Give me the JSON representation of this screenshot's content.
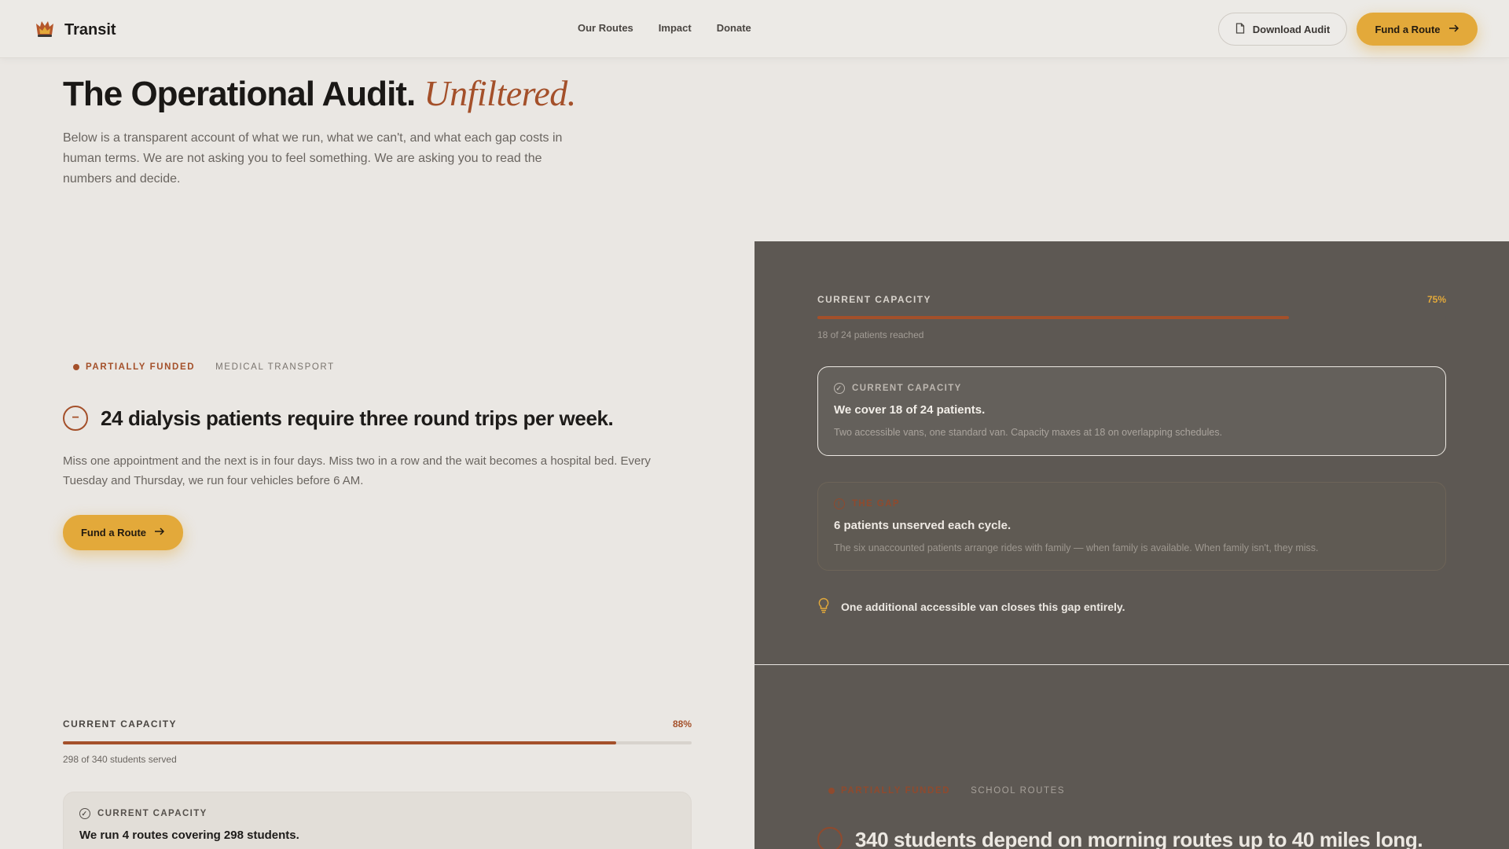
{
  "header": {
    "logo_text": "Transit",
    "logo_icon": "flame-emblem-icon",
    "nav": [
      "Our Routes",
      "Impact",
      "Donate"
    ],
    "download_label": "Download Audit",
    "fund_label": "Fund a Route"
  },
  "hero": {
    "title": "The Operational Audit.",
    "title_accent": "Unfiltered.",
    "intro": "Below is a transparent account of what we run, what we can't, and what each gap costs in human terms. We are not asking you to feel something. We are asking you to read the numbers and decide."
  },
  "medical": {
    "status": "PARTIALLY FUNDED",
    "category": "MEDICAL TRANSPORT",
    "headline": "24 dialysis patients require three round trips per week.",
    "body": "Miss one appointment and the next is in four days. Miss two in a row and the wait becomes a hospital bed. Every Tuesday and Thursday, we run four vehicles before 6 AM.",
    "cta": "Fund a Route",
    "capacity": {
      "label": "CURRENT CAPACITY",
      "percent_text": "75%",
      "fill": 0.75,
      "sub": "18 of 24 patients reached"
    },
    "card1": {
      "label": "CURRENT CAPACITY",
      "title": "We cover 18 of 24 patients.",
      "desc": "Two accessible vans, one standard van. Capacity maxes at 18 on overlapping schedules."
    },
    "card2": {
      "label": "THE GAP",
      "title": "6 patients unserved each cycle.",
      "desc": "The six unaccounted patients arrange rides with family — when family is available. When family isn't, they miss."
    },
    "tip": "One additional accessible van closes this gap entirely."
  },
  "school": {
    "capacity": {
      "label": "CURRENT CAPACITY",
      "percent_text": "88%",
      "fill": 0.88,
      "sub": "298 of 340 students served"
    },
    "card1": {
      "label": "CURRENT CAPACITY",
      "title": "We run 4 routes covering 298 students."
    },
    "status": "PARTIALLY FUNDED",
    "category": "SCHOOL ROUTES",
    "headline": "340 students depend on morning routes up to 40 miles long."
  },
  "colors": {
    "accent": "#a4502a",
    "primary_button": "#e3a93a",
    "dark_panel": "#5d5853",
    "background": "#eae7e3"
  }
}
